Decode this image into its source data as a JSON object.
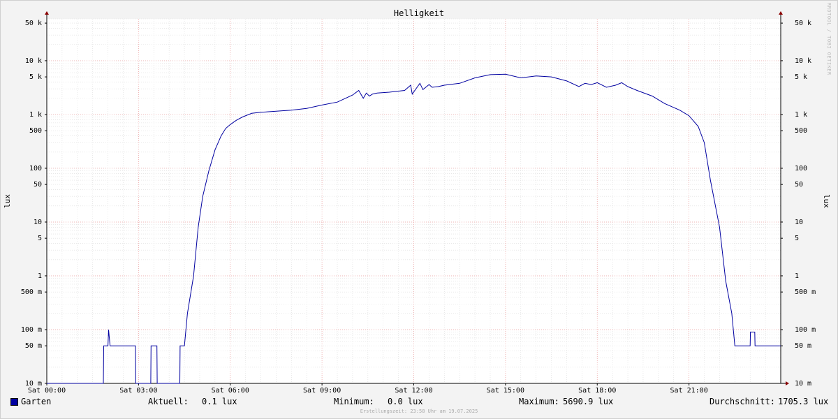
{
  "chart_data": {
    "type": "line",
    "title": "Helligkeit",
    "ylabel": "lux",
    "y_scale": "log",
    "ylim": [
      0.01,
      60000
    ],
    "y_ticks": [
      {
        "value": 50000,
        "label": "50 k"
      },
      {
        "value": 10000,
        "label": "10 k"
      },
      {
        "value": 5000,
        "label": "5 k"
      },
      {
        "value": 1000,
        "label": "1 k"
      },
      {
        "value": 500,
        "label": "500"
      },
      {
        "value": 100,
        "label": "100"
      },
      {
        "value": 50,
        "label": "50"
      },
      {
        "value": 10,
        "label": "10"
      },
      {
        "value": 5,
        "label": "5"
      },
      {
        "value": 1,
        "label": "1"
      },
      {
        "value": 0.5,
        "label": "500 m"
      },
      {
        "value": 0.1,
        "label": "100 m"
      },
      {
        "value": 0.05,
        "label": "50 m"
      },
      {
        "value": 0.01,
        "label": "10 m"
      }
    ],
    "xlim": [
      0,
      24
    ],
    "x_ticks": [
      {
        "value": 0,
        "label": "Sat 00:00"
      },
      {
        "value": 3,
        "label": "Sat 03:00"
      },
      {
        "value": 6,
        "label": "Sat 06:00"
      },
      {
        "value": 9,
        "label": "Sat 09:00"
      },
      {
        "value": 12,
        "label": "Sat 12:00"
      },
      {
        "value": 15,
        "label": "Sat 15:00"
      },
      {
        "value": 18,
        "label": "Sat 18:00"
      },
      {
        "value": 21,
        "label": "Sat 21:00"
      }
    ],
    "grid": true,
    "color": "#0000a0",
    "series": [
      {
        "name": "Garten",
        "x": [
          0,
          1.85,
          1.86,
          2.0,
          2.02,
          2.07,
          2.1,
          2.9,
          2.91,
          3.4,
          3.41,
          3.6,
          3.61,
          4.35,
          4.36,
          4.5,
          4.6,
          4.8,
          4.95,
          5.1,
          5.3,
          5.5,
          5.7,
          5.85,
          6.0,
          6.2,
          6.4,
          6.7,
          7.0,
          7.5,
          8.0,
          8.5,
          9.0,
          9.5,
          10.0,
          10.2,
          10.35,
          10.45,
          10.55,
          10.65,
          10.8,
          11.2,
          11.7,
          11.9,
          11.95,
          12.2,
          12.3,
          12.5,
          12.6,
          12.8,
          13.0,
          13.5,
          14.0,
          14.5,
          15.0,
          15.5,
          16.0,
          16.5,
          17.0,
          17.4,
          17.6,
          17.8,
          18.0,
          18.3,
          18.6,
          18.8,
          19.0,
          19.3,
          19.8,
          20.2,
          20.7,
          21.0,
          21.3,
          21.5,
          21.7,
          22.0,
          22.2,
          22.4,
          22.5,
          22.8,
          22.81,
          23.0,
          23.01,
          23.15,
          23.16,
          24.0
        ],
        "values": [
          0.01,
          0.01,
          0.05,
          0.05,
          0.1,
          0.05,
          0.05,
          0.05,
          0.01,
          0.01,
          0.05,
          0.05,
          0.01,
          0.01,
          0.05,
          0.05,
          0.2,
          1,
          8,
          30,
          90,
          220,
          400,
          550,
          650,
          780,
          900,
          1050,
          1100,
          1150,
          1200,
          1300,
          1500,
          1700,
          2300,
          2800,
          2000,
          2500,
          2200,
          2400,
          2500,
          2600,
          2800,
          3500,
          2400,
          3800,
          2900,
          3600,
          3200,
          3300,
          3500,
          3800,
          4800,
          5500,
          5600,
          4800,
          5200,
          5000,
          4200,
          3300,
          3800,
          3600,
          3900,
          3200,
          3500,
          3900,
          3300,
          2800,
          2200,
          1600,
          1200,
          950,
          600,
          300,
          60,
          8,
          0.8,
          0.2,
          0.05,
          0.05,
          0.05,
          0.05,
          0.09,
          0.09,
          0.05,
          0.05
        ]
      }
    ]
  },
  "legend": {
    "series_name": "Garten",
    "current_label": "Aktuell:",
    "current_value": "0.1 lux",
    "min_label": "Minimum:",
    "min_value": "0.0 lux",
    "max_label": "Maximum:",
    "max_value": "5690.9 lux",
    "avg_label": "Durchschnitt:",
    "avg_value": "1705.3 lux"
  },
  "footer": "Erstellungszeit: 23:58 Uhr am 19.07.2025",
  "watermark": "RRDTOOL / TOBI OETIKER"
}
